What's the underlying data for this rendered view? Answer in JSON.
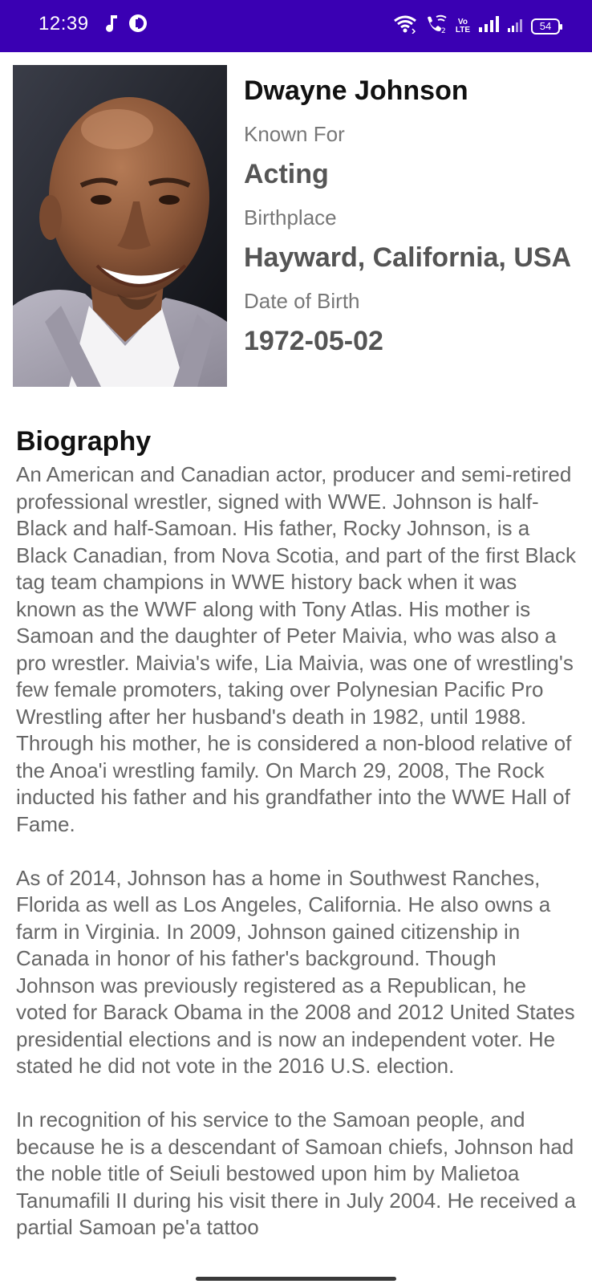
{
  "status_bar": {
    "time": "12:39",
    "battery": "54",
    "network_label_top": "Vo",
    "network_label_bottom": "LTE",
    "bg_color": "#3a00b3",
    "icons_left": [
      "music-note-icon",
      "round-app-icon"
    ],
    "icons_right": [
      "wifi-icon",
      "wifi-calling-icon",
      "volte-icon",
      "signal-icon",
      "signal-weak-icon",
      "battery-icon"
    ]
  },
  "person": {
    "name": "Dwayne Johnson",
    "known_for_label": "Known For",
    "known_for": "Acting",
    "birthplace_label": "Birthplace",
    "birthplace": "Hayward, California, USA",
    "dob_label": "Date of Birth",
    "dob": "1972-05-02"
  },
  "biography": {
    "heading": "Biography",
    "paragraphs": [
      "An American and Canadian actor, producer and semi-retired professional wrestler, signed with WWE. Johnson is half-Black and half-Samoan. His father, Rocky Johnson, is a Black Canadian, from Nova Scotia, and part of the first Black tag team champions in WWE history back when it was known as the WWF along with Tony Atlas. His mother is Samoan and the daughter of Peter Maivia, who was also a pro wrestler. Maivia's wife, Lia Maivia, was one of wrestling's few female promoters, taking over Polynesian Pacific Pro Wrestling after her husband's death in 1982, until 1988. Through his mother, he is considered a non-blood relative of the Anoa'i wrestling family. On March 29, 2008, The Rock inducted his father and his grandfather into the WWE Hall of Fame.",
      "As of 2014, Johnson has a home in Southwest Ranches, Florida as well as Los Angeles, California. He also owns a farm in Virginia. In 2009, Johnson gained citizenship in Canada in honor of his father's background. Though Johnson was previously registered as a Republican, he voted for Barack Obama in the 2008 and 2012 United States presidential elections and is now an independent voter. He stated he did not vote in the 2016 U.S. election.",
      "In recognition of his service to the Samoan people, and because he is a descendant of Samoan chiefs, Johnson had the noble title of Seiuli bestowed upon him by Malietoa Tanumafili II during his visit there in July 2004. He received a partial Samoan pe'a tattoo"
    ]
  }
}
